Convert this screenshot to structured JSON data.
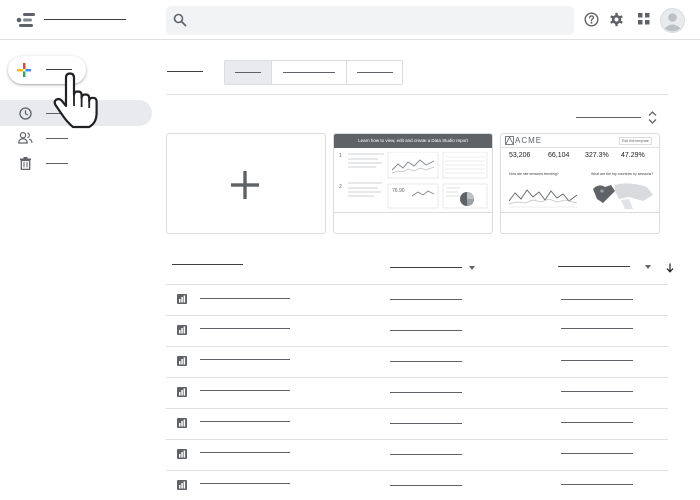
{
  "header": {
    "logo_icon": "data-studio-logo-icon",
    "search_icon": "search-icon",
    "help_icon": "help-icon",
    "settings_icon": "gear-icon",
    "apps_icon": "apps-grid-icon",
    "avatar_icon": "account-avatar-icon"
  },
  "create_button": {
    "icon": "plus-icon",
    "cursor": "hand-pointer-cursor"
  },
  "sidebar": {
    "items": [
      {
        "icon": "clock-icon",
        "active": true
      },
      {
        "icon": "people-icon",
        "active": false
      },
      {
        "icon": "trash-icon",
        "active": false
      }
    ]
  },
  "templates": {
    "blank": {
      "icon": "plus-icon"
    },
    "tutorial": {
      "title": "Learn how to view, edit and create a Data Studio report",
      "step1": "1",
      "step2": "2",
      "metric": "76.90"
    },
    "acme": {
      "logo": "ACME",
      "button": "Edit this template",
      "kpis": [
        {
          "value": "53,206"
        },
        {
          "value": "66,104"
        },
        {
          "value": "327.3%"
        },
        {
          "value": "47.29%"
        }
      ],
      "q1": "How are site sessions trending?",
      "q2": "What are the top countries by sessions?"
    }
  },
  "table": {
    "row_icon": "report-bar-chart-icon",
    "sort_icon": "arrow-down-icon",
    "row_count": 7
  },
  "colors": {
    "google_blue": "#4285f4",
    "google_red": "#ea4335",
    "google_yellow": "#fbbc04",
    "google_green": "#34a853",
    "gray": "#5f6368"
  }
}
